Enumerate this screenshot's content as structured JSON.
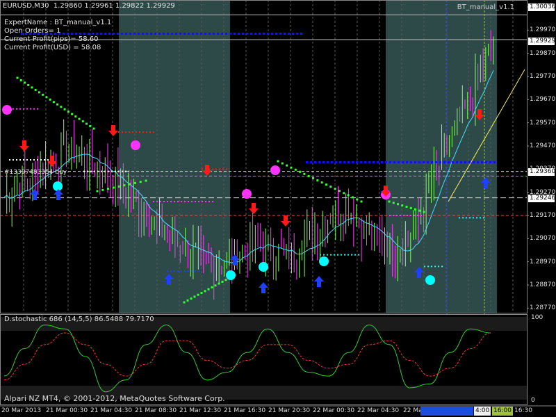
{
  "header": {
    "symbol": "EURUSD,M30",
    "ohlc": "1.29860 1.29961 1.29822 1.29929",
    "ea_label": "BT_manual_v1.1"
  },
  "info_panel": [
    "ExpertName : BT_manual_v1.1",
    "Open Orders= 1",
    "Current Profit(pips)= 58.60",
    "Current Profit(USD) = 58.08"
  ],
  "order_label": "#13397483354 buy",
  "stochastic": {
    "title": "D.stochastic 686 (14,5,5) 86.5488 79.7170",
    "scale_high": "100",
    "scale_low": "0"
  },
  "footer": "Alpari NZ MT4, © 2001-2012, MetaQuotes Software Corp.",
  "price_axis": [
    "1.30070",
    "1.29970",
    "1.29870",
    "1.29770",
    "1.29670",
    "1.29570",
    "1.29470",
    "1.29370",
    "1.29270",
    "1.29170",
    "1.29070",
    "1.28970",
    "1.28870",
    "1.28770"
  ],
  "price_tags": {
    "top": "1.30036",
    "current": "1.29929",
    "order": "1.29360",
    "line": "1.29246"
  },
  "time_axis": [
    "20 Mar 2013",
    "21 Mar 00:30",
    "21 Mar 04:30",
    "21 Mar 08:30",
    "21 Mar 12:30",
    "21 Mar 16:30",
    "21 Mar 20:30",
    "22 Mar 00:30",
    "22 Mar 04:30",
    "22 Mar",
    "16:30"
  ],
  "time_tags": [
    "4:00",
    "16:00"
  ],
  "colors": {
    "background": "#000000",
    "session_band": "#2e4a48",
    "bull_candle": "#7fff5a",
    "bear_candle": "#ff40ff",
    "ma_line": "#40e0ff",
    "signal_buy": "#2040ff",
    "signal_sell": "#ff1a1a",
    "dot_green": "#33ff33",
    "dot_blue": "#1010ff",
    "magenta": "#ff33ff",
    "cyan": "#00ffff",
    "stoch_main": "#33cc33",
    "stoch_signal": "#ff3333"
  },
  "chart_data": {
    "type": "candlestick",
    "symbol": "EURUSD",
    "timeframe": "M30",
    "ylim": [
      1.2875,
      1.301
    ],
    "close_path": [
      1.2925,
      1.293,
      1.2935,
      1.294,
      1.2945,
      1.2942,
      1.2938,
      1.2932,
      1.2925,
      1.2918,
      1.291,
      1.2905,
      1.29,
      1.2895,
      1.2898,
      1.2902,
      1.2905,
      1.2902,
      1.29,
      1.2905,
      1.2912,
      1.292,
      1.2918,
      1.291,
      1.2905,
      1.2902,
      1.291,
      1.293,
      1.2945,
      1.296,
      1.2975,
      1.2993
    ],
    "stochastic_main": [
      30,
      65,
      95,
      90,
      55,
      10,
      25,
      70,
      95,
      60,
      25,
      35,
      60,
      90,
      60,
      35,
      30,
      60,
      95,
      70,
      15,
      20,
      60,
      90,
      85
    ],
    "stochastic_signal": [
      25,
      45,
      70,
      85,
      70,
      45,
      30,
      45,
      75,
      75,
      50,
      40,
      50,
      70,
      70,
      50,
      40,
      45,
      70,
      75,
      50,
      30,
      40,
      65,
      85
    ]
  }
}
